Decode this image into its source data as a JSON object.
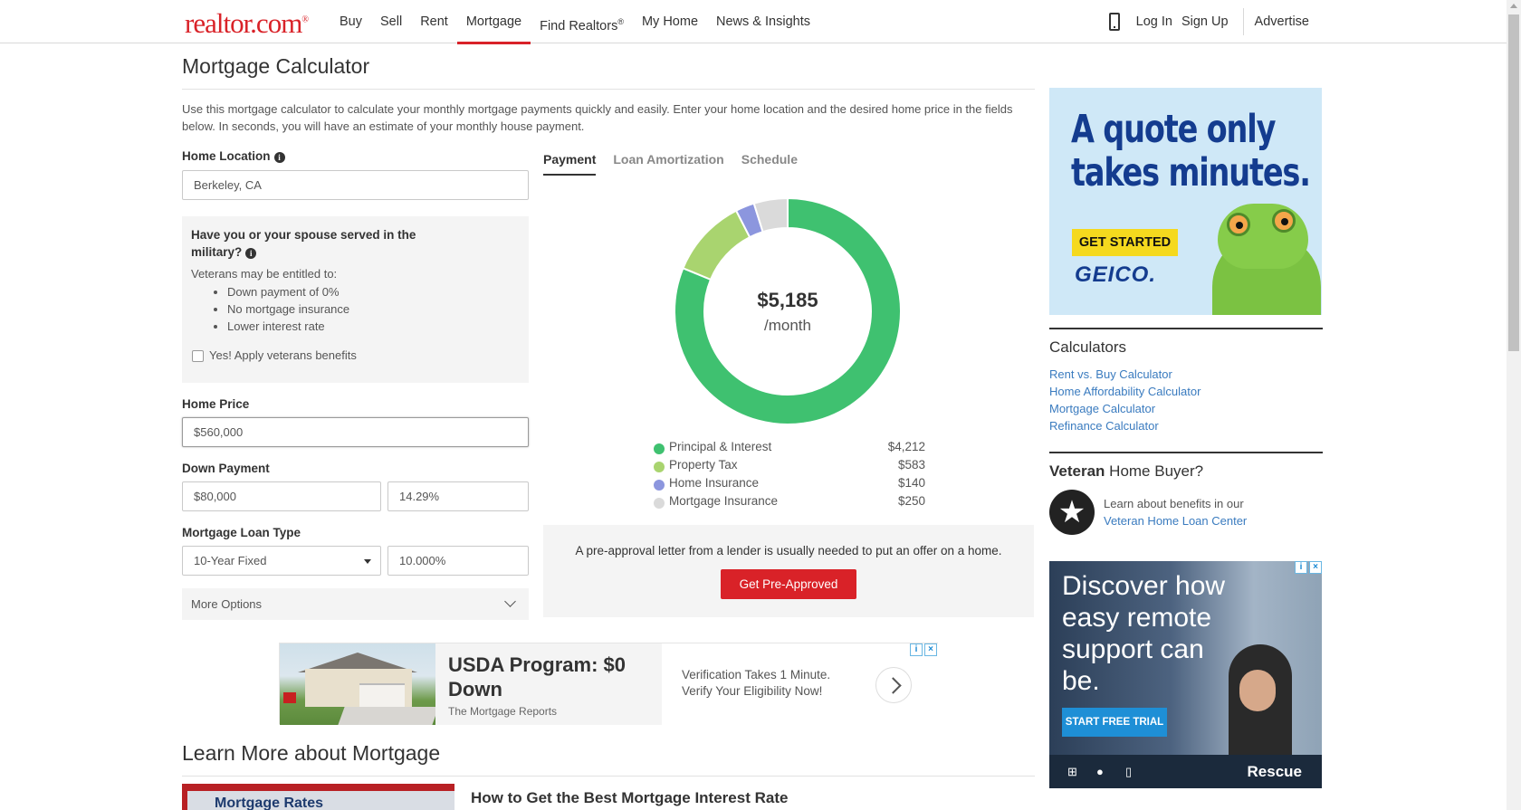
{
  "header": {
    "logo": "realtor.com",
    "logo_mark": "®",
    "nav": [
      "Buy",
      "Sell",
      "Rent",
      "Mortgage",
      "Find Realtors",
      "My Home",
      "News & Insights"
    ],
    "nav_sup": "®",
    "login": "Log In",
    "signup": "Sign Up",
    "advertise": "Advertise"
  },
  "main": {
    "title": "Mortgage Calculator",
    "intro": "Use this mortgage calculator to calculate your monthly mortgage payments quickly and easily. Enter your home location and the desired home price in the fields below. In seconds, you will have an estimate of your monthly house payment."
  },
  "form": {
    "home_location_label": "Home Location",
    "home_location_value": "Berkeley, CA",
    "military_question": "Have you or your spouse served in the military?",
    "veterans_intro": "Veterans may be entitled to:",
    "veterans_benefits": [
      "Down payment of 0%",
      "No mortgage insurance",
      "Lower interest rate"
    ],
    "apply_benefits_label": "Yes! Apply veterans benefits",
    "home_price_label": "Home Price",
    "home_price_value": "$560,000",
    "down_payment_label": "Down Payment",
    "down_payment_amount": "$80,000",
    "down_payment_percent": "14.29%",
    "loan_type_label": "Mortgage Loan Type",
    "loan_type_value": "10-Year Fixed",
    "interest_rate": "10.000%",
    "more_options": "More Options"
  },
  "tabs": [
    "Payment",
    "Loan Amortization",
    "Schedule"
  ],
  "chart_data": {
    "type": "pie",
    "variant": "donut",
    "center_value": "$5,185",
    "center_unit": "/month",
    "categories": [
      "Principal & Interest",
      "Property Tax",
      "Home Insurance",
      "Mortgage Insurance"
    ],
    "values": [
      4212,
      583,
      140,
      250
    ],
    "value_labels": [
      "$4,212",
      "$583",
      "$140",
      "$250"
    ],
    "colors": [
      "#3fc170",
      "#a9d46f",
      "#8c96de",
      "#dadada"
    ]
  },
  "preapproval": {
    "text": "A pre-approval letter from a lender is usually needed to put an offer on a home.",
    "button": "Get Pre-Approved"
  },
  "usda_ad": {
    "title": "USDA Program: $0 Down",
    "source": "The Mortgage Reports",
    "desc_line1": "Verification Takes 1 Minute.",
    "desc_line2": "Verify Your Eligibility Now!"
  },
  "learn": {
    "title": "Learn More about Mortgage",
    "thumb_text": "Mortgage Rates",
    "article_title": "How to Get the Best Mortgage Interest Rate"
  },
  "geico_ad": {
    "headline_line1": "A quote only",
    "headline_line2": "takes minutes.",
    "button": "GET STARTED",
    "brand": "GEICO."
  },
  "sidebar": {
    "calculators_title": "Calculators",
    "calculator_links": [
      "Rent vs. Buy Calculator",
      "Home Affordability Calculator",
      "Mortgage Calculator",
      "Refinance Calculator"
    ],
    "veteran_title_bold": "Veteran",
    "veteran_title_rest": " Home Buyer?",
    "veteran_text": "Learn about benefits in our",
    "veteran_link": "Veteran Home Loan Center"
  },
  "rescue_ad": {
    "headline": "Discover how easy remote support can be.",
    "button": "START FREE TRIAL",
    "brand": "Rescue"
  }
}
